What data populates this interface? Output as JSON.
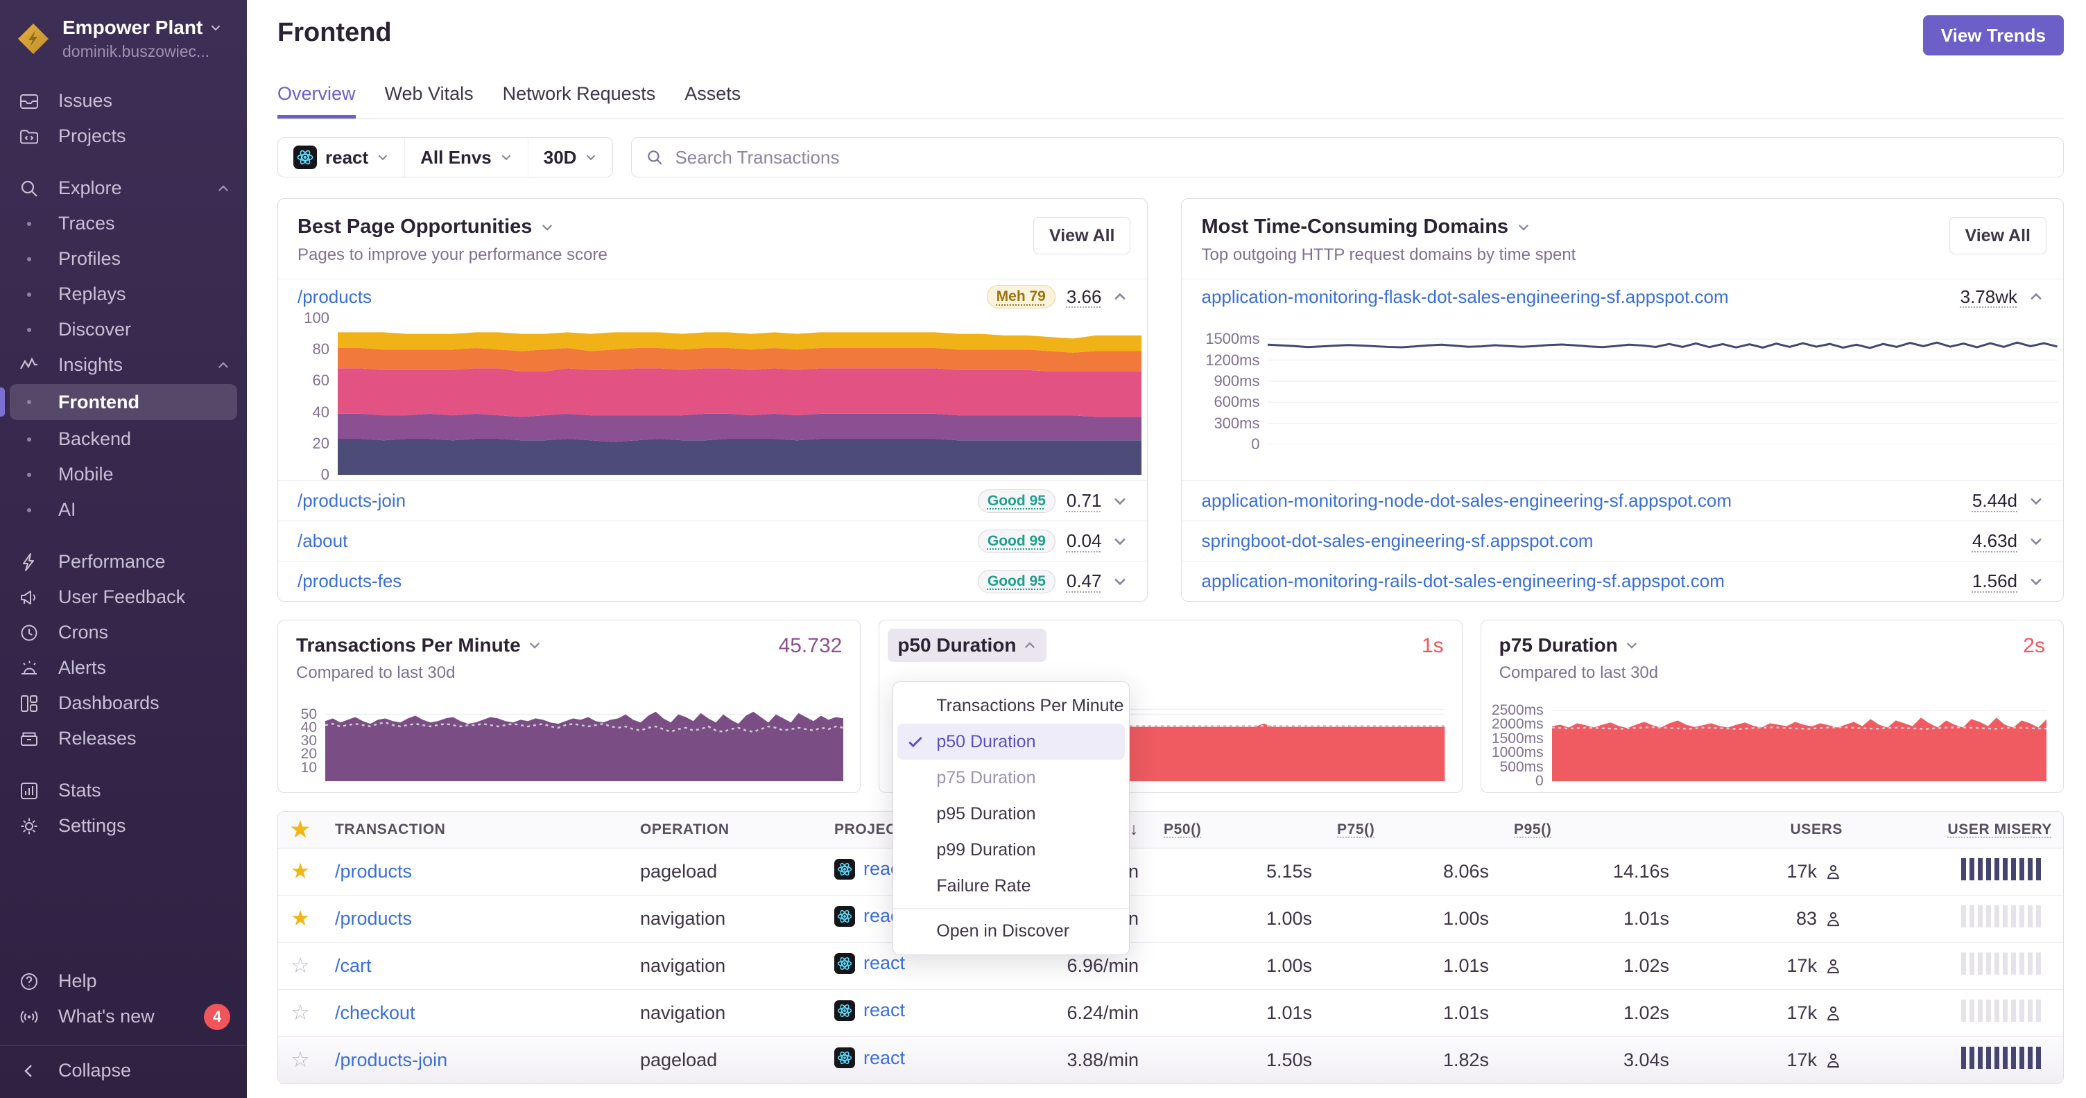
{
  "sidebar": {
    "org": {
      "name": "Empower Plant",
      "user": "dominik.buszowiec..."
    },
    "items": [
      {
        "id": "issues",
        "label": "Issues",
        "icon": "issues-icon"
      },
      {
        "id": "projects",
        "label": "Projects",
        "icon": "projects-icon"
      },
      {
        "id": "explore",
        "label": "Explore",
        "icon": "search-icon",
        "expandable": true,
        "gap": true
      },
      {
        "id": "traces",
        "label": "Traces",
        "sub": true
      },
      {
        "id": "profiles",
        "label": "Profiles",
        "sub": true
      },
      {
        "id": "replays",
        "label": "Replays",
        "sub": true
      },
      {
        "id": "discover",
        "label": "Discover",
        "sub": true
      },
      {
        "id": "insights",
        "label": "Insights",
        "icon": "insights-icon",
        "expandable": true
      },
      {
        "id": "frontend",
        "label": "Frontend",
        "sub": true,
        "active": true
      },
      {
        "id": "backend",
        "label": "Backend",
        "sub": true
      },
      {
        "id": "mobile",
        "label": "Mobile",
        "sub": true
      },
      {
        "id": "ai",
        "label": "AI",
        "sub": true
      },
      {
        "id": "performance",
        "label": "Performance",
        "icon": "lightning-icon",
        "gap": true
      },
      {
        "id": "user-feedback",
        "label": "User Feedback",
        "icon": "megaphone-icon"
      },
      {
        "id": "crons",
        "label": "Crons",
        "icon": "clock-icon"
      },
      {
        "id": "alerts",
        "label": "Alerts",
        "icon": "siren-icon"
      },
      {
        "id": "dashboards",
        "label": "Dashboards",
        "icon": "dashboards-icon"
      },
      {
        "id": "releases",
        "label": "Releases",
        "icon": "box-icon"
      },
      {
        "id": "stats",
        "label": "Stats",
        "icon": "bar-chart-icon",
        "gap": true
      },
      {
        "id": "settings",
        "label": "Settings",
        "icon": "gear-icon"
      }
    ],
    "footer": [
      {
        "id": "help",
        "label": "Help",
        "icon": "help-icon"
      },
      {
        "id": "whats-new",
        "label": "What's new",
        "icon": "broadcast-icon",
        "badge": "4"
      },
      {
        "id": "collapse",
        "label": "Collapse",
        "icon": "collapse-icon",
        "divider": true
      }
    ]
  },
  "header": {
    "title": "Frontend",
    "view_trends": "View Trends",
    "tabs": [
      {
        "label": "Overview",
        "active": true
      },
      {
        "label": "Web Vitals"
      },
      {
        "label": "Network Requests"
      },
      {
        "label": "Assets"
      }
    ]
  },
  "filters": {
    "project": "react",
    "env": "All Envs",
    "period": "30D",
    "search_placeholder": "Search Transactions"
  },
  "panels": {
    "bpo": {
      "title": "Best Page Opportunities",
      "subtitle": "Pages to improve your performance score",
      "view_all": "View All",
      "rows": [
        {
          "page": "/products",
          "badge": "Meh 79",
          "badge_type": "meh",
          "value": "3.66",
          "expanded": true
        },
        {
          "page": "/products-join",
          "badge": "Good 95",
          "badge_type": "good",
          "value": "0.71"
        },
        {
          "page": "/about",
          "badge": "Good 99",
          "badge_type": "good",
          "value": "0.04"
        },
        {
          "page": "/products-fes",
          "badge": "Good 95",
          "badge_type": "good",
          "value": "0.47"
        }
      ]
    },
    "domains": {
      "title": "Most Time-Consuming Domains",
      "subtitle": "Top outgoing HTTP request domains by time spent",
      "view_all": "View All",
      "rows": [
        {
          "domain": "application-monitoring-flask-dot-sales-engineering-sf.appspot.com",
          "value": "3.78wk",
          "expanded": true
        },
        {
          "domain": "application-monitoring-node-dot-sales-engineering-sf.appspot.com",
          "value": "5.44d"
        },
        {
          "domain": "springboot-dot-sales-engineering-sf.appspot.com",
          "value": "4.63d"
        },
        {
          "domain": "application-monitoring-rails-dot-sales-engineering-sf.appspot.com",
          "value": "1.56d"
        }
      ]
    },
    "tpm": {
      "title": "Transactions Per Minute",
      "value": "45.732",
      "subtitle": "Compared to last 30d"
    },
    "p50": {
      "title": "p50 Duration",
      "value": "1s"
    },
    "p75": {
      "title": "p75 Duration",
      "value": "2s",
      "subtitle": "Compared to last 30d"
    }
  },
  "dropdown": {
    "items": [
      {
        "label": "Transactions Per Minute"
      },
      {
        "label": "p50 Duration",
        "selected": true
      },
      {
        "label": "p75 Duration",
        "disabled": true
      },
      {
        "label": "p95 Duration"
      },
      {
        "label": "p99 Duration"
      },
      {
        "label": "Failure Rate"
      },
      {
        "label": "Open in Discover",
        "separated": true
      }
    ]
  },
  "table": {
    "sort_icon": "↓",
    "headers": [
      {
        "icon": "star",
        "align": "c"
      },
      {
        "label": "TRANSACTION"
      },
      {
        "label": "OPERATION"
      },
      {
        "label": "PROJECT"
      },
      {
        "label": "",
        "sort": "desc",
        "align": "r"
      },
      {
        "label": "P50()",
        "sortable": true
      },
      {
        "label": "P75()",
        "sortable": true
      },
      {
        "label": "P95()",
        "sortable": true
      },
      {
        "label": "USERS",
        "align": "r"
      },
      {
        "label": "USER MISERY",
        "sortable": true,
        "align": "r"
      }
    ],
    "rows": [
      {
        "starred": true,
        "transaction": "/products",
        "operation": "pageload",
        "project": "react",
        "tpm": "in",
        "p50": "5.15s",
        "p75": "8.06s",
        "p95": "14.16s",
        "users": "17k",
        "misery": "high"
      },
      {
        "starred": true,
        "transaction": "/products",
        "operation": "navigation",
        "project": "react",
        "tpm": "in",
        "p50": "1.00s",
        "p75": "1.00s",
        "p95": "1.01s",
        "users": "83",
        "misery": "low"
      },
      {
        "starred": false,
        "transaction": "/cart",
        "operation": "navigation",
        "project": "react",
        "tpm": "6.96/min",
        "p50": "1.00s",
        "p75": "1.01s",
        "p95": "1.02s",
        "users": "17k",
        "misery": "low"
      },
      {
        "starred": false,
        "transaction": "/checkout",
        "operation": "navigation",
        "project": "react",
        "tpm": "6.24/min",
        "p50": "1.01s",
        "p75": "1.01s",
        "p95": "1.02s",
        "users": "17k",
        "misery": "low"
      },
      {
        "starred": false,
        "transaction": "/products-join",
        "operation": "pageload",
        "project": "react",
        "tpm": "3.88/min",
        "p50": "1.50s",
        "p75": "1.82s",
        "p95": "3.04s",
        "users": "17k",
        "misery": "high"
      }
    ]
  },
  "icons": {
    "search-icon": "magnifier",
    "gear-icon": "gear",
    "star-icon": "star",
    "person-icon": "user silhouette",
    "chevron-down-icon": "v",
    "chevron-up-icon": "^",
    "check-icon": "checkmark",
    "react-icon": "react atom",
    "broadcast-icon": "((o))",
    "collapse-icon": "<",
    "sort-desc-icon": "down arrow"
  },
  "colors": {
    "accent": "#6C5FC7",
    "link": "#3A6FD6",
    "red": "#F0555C",
    "plum": "#8D4E8F",
    "stack": [
      "#4D4C78",
      "#8A5092",
      "#E25283",
      "#F2793C",
      "#F0B216"
    ],
    "domain_line": "#444674",
    "misery_high": "#46456F",
    "misery_low": "#E5E3E9",
    "badge_good_text": "#1D9F8B",
    "badge_meh_text": "#9A7410",
    "whats_new_badge": "#F0555C"
  },
  "chart_data": [
    {
      "id": "score-breakdown",
      "type": "area",
      "stacked": true,
      "panel": "Best Page Opportunities /products",
      "ylim": [
        0,
        100
      ],
      "yticks": [
        {
          "v": 100,
          "label": "100"
        },
        {
          "v": 80,
          "label": "80"
        },
        {
          "v": 60,
          "label": "60"
        },
        {
          "v": 40,
          "label": "40"
        },
        {
          "v": 20,
          "label": "20"
        },
        {
          "v": 0,
          "label": "0"
        }
      ],
      "series": [
        {
          "color": "#4D4C78",
          "values": [
            23,
            23,
            22,
            23,
            23,
            22,
            23,
            23,
            22,
            22,
            23,
            22,
            21,
            22,
            23,
            22,
            22,
            23,
            23,
            23,
            22,
            23,
            23,
            23,
            23,
            23,
            23,
            22,
            22,
            22,
            22,
            22,
            22,
            22,
            22,
            22
          ]
        },
        {
          "color": "#8A5092",
          "values": [
            16,
            16,
            16,
            15,
            16,
            16,
            16,
            15,
            15,
            16,
            16,
            16,
            17,
            16,
            15,
            16,
            17,
            16,
            15,
            16,
            16,
            16,
            16,
            16,
            16,
            16,
            16,
            16,
            16,
            16,
            16,
            16,
            16,
            15,
            15,
            15
          ]
        },
        {
          "color": "#E25283",
          "values": [
            29,
            29,
            29,
            29,
            28,
            29,
            29,
            30,
            29,
            28,
            29,
            29,
            29,
            30,
            30,
            29,
            29,
            29,
            29,
            29,
            29,
            29,
            29,
            29,
            29,
            29,
            29,
            29,
            29,
            29,
            29,
            28,
            28,
            29,
            29,
            29
          ]
        },
        {
          "color": "#F2793C",
          "values": [
            13,
            13,
            13,
            13,
            13,
            13,
            13,
            12,
            13,
            14,
            13,
            12,
            13,
            13,
            13,
            13,
            13,
            13,
            13,
            13,
            13,
            13,
            13,
            13,
            13,
            13,
            13,
            13,
            13,
            13,
            13,
            13,
            12,
            13,
            13,
            13
          ]
        },
        {
          "color": "#F0B216",
          "values": [
            10,
            10,
            11,
            10,
            10,
            10,
            10,
            11,
            11,
            10,
            10,
            11,
            11,
            10,
            10,
            10,
            10,
            10,
            10,
            10,
            10,
            10,
            10,
            10,
            10,
            10,
            10,
            10,
            10,
            9,
            9,
            9,
            9,
            10,
            10,
            10
          ]
        }
      ]
    },
    {
      "id": "domain-response",
      "type": "line",
      "panel": "Most Time-Consuming Domains flask",
      "ylim": [
        0,
        1600
      ],
      "color": "#444674",
      "grid": [
        1500,
        1200,
        900,
        600,
        300,
        0
      ],
      "yticks": [
        {
          "v": 1500,
          "label": "1500ms"
        },
        {
          "v": 1200,
          "label": "1200ms"
        },
        {
          "v": 900,
          "label": "900ms"
        },
        {
          "v": 600,
          "label": "600ms"
        },
        {
          "v": 300,
          "label": "300ms"
        },
        {
          "v": 0,
          "label": "0"
        }
      ],
      "values": [
        1420,
        1410,
        1400,
        1385,
        1395,
        1405,
        1415,
        1408,
        1398,
        1388,
        1383,
        1395,
        1410,
        1420,
        1405,
        1390,
        1396,
        1412,
        1400,
        1390,
        1400,
        1415,
        1422,
        1410,
        1395,
        1385,
        1400,
        1420,
        1408,
        1388,
        1430,
        1388,
        1438,
        1385,
        1428,
        1380,
        1425,
        1378,
        1435,
        1388,
        1440,
        1392,
        1430,
        1378,
        1420,
        1374,
        1430,
        1388,
        1445,
        1398,
        1450,
        1392,
        1435,
        1383,
        1440,
        1388,
        1450,
        1398,
        1440,
        1393
      ]
    },
    {
      "id": "tpm",
      "type": "area",
      "panel": "Transactions Per Minute",
      "ylim": [
        0,
        55
      ],
      "color": "#7A4E85",
      "grid": [
        50
      ],
      "yticks": [
        {
          "v": 50,
          "label": "50"
        },
        {
          "v": 40,
          "label": "40"
        },
        {
          "v": 30,
          "label": "30"
        },
        {
          "v": 20,
          "label": "20"
        },
        {
          "v": 10,
          "label": "10"
        }
      ],
      "values": [
        45,
        47,
        44,
        46,
        48,
        45,
        43,
        46,
        47,
        45,
        44,
        47,
        49,
        46,
        44,
        45,
        47,
        48,
        45,
        43,
        44,
        46,
        48,
        47,
        45,
        44,
        46,
        45,
        47,
        46,
        44,
        43,
        45,
        47,
        46,
        48,
        45,
        44,
        46,
        47,
        50,
        46,
        44,
        49,
        52,
        47,
        44,
        50,
        48,
        45,
        51,
        47,
        44,
        50,
        46,
        43,
        49,
        52,
        48,
        44,
        50,
        47,
        44,
        51,
        48,
        45,
        49,
        46,
        48,
        47
      ],
      "compare": {
        "color": "#CFC9D6",
        "values": [
          42,
          43,
          41,
          42,
          43,
          42,
          41,
          43,
          44,
          42,
          41,
          42,
          43,
          42,
          41,
          42,
          43,
          42,
          41,
          42,
          42,
          43,
          42,
          41,
          42,
          43,
          42,
          41,
          42,
          43,
          41,
          40,
          42,
          43,
          42,
          41,
          42,
          43,
          41,
          40,
          41,
          39,
          38,
          40,
          41,
          39,
          37,
          39,
          40,
          38,
          39,
          41,
          38,
          37,
          39,
          40,
          38,
          37,
          39,
          41,
          40,
          38,
          39,
          40,
          39,
          38,
          40,
          39,
          41,
          40
        ]
      }
    },
    {
      "id": "p50",
      "type": "area",
      "panel": "p50 Duration",
      "ylim": [
        0,
        1350
      ],
      "color": "#EF5B61",
      "grid": [
        1320,
        1230
      ],
      "yticks": [],
      "values": [
        1000,
        1000,
        1000,
        1000,
        1000,
        1000,
        1000,
        1000,
        1000,
        1000,
        1000,
        1000,
        1240,
        1000,
        1000,
        1000,
        1000,
        1000,
        1000,
        1000,
        1000,
        1000,
        1000,
        1000,
        1000,
        1000,
        1000,
        1000,
        1000,
        1000,
        1000,
        1000,
        1000,
        1000,
        1000,
        1000,
        1000,
        1000,
        1060,
        1000,
        1000,
        1000,
        1000,
        1000,
        1000,
        1000,
        1000,
        1000,
        1000,
        1000,
        1000,
        1000,
        1000,
        1000,
        1000,
        1000,
        1000,
        1000,
        1000,
        1000
      ],
      "compare": {
        "color": "#CFC9D6",
        "values": [
          1015,
          1015
        ]
      }
    },
    {
      "id": "p75",
      "type": "area",
      "panel": "p75 Duration",
      "ylim": [
        0,
        2600
      ],
      "color": "#EF5B61",
      "grid": [
        2500
      ],
      "yticks": [
        {
          "v": 2500,
          "label": "2500ms"
        },
        {
          "v": 2000,
          "label": "2000ms"
        },
        {
          "v": 1500,
          "label": "1500ms"
        },
        {
          "v": 1000,
          "label": "1000ms"
        },
        {
          "v": 500,
          "label": "500ms"
        },
        {
          "v": 0,
          "label": "0"
        }
      ],
      "values": [
        1950,
        2000,
        1900,
        2050,
        1980,
        1900,
        2000,
        2080,
        1950,
        1880,
        2000,
        2100,
        1980,
        1900,
        2050,
        2150,
        2000,
        1920,
        1980,
        2050,
        1950,
        1900,
        2000,
        2080,
        1960,
        1900,
        2050,
        2000,
        1950,
        2100,
        2000,
        1940,
        2050,
        1980,
        1900,
        2000,
        2100,
        1950,
        2200,
        2000,
        1900,
        2150,
        2050,
        1950,
        2250,
        2050,
        1900,
        2150,
        2000,
        1900,
        2200,
        2100,
        1950,
        2250,
        2000,
        1900,
        2150,
        2050,
        1900,
        2200
      ],
      "compare": {
        "color": "#CFC9D6",
        "values": [
          1900,
          1860,
          1895,
          1870,
          1850,
          1890,
          1915,
          1880,
          1850,
          1900,
          1870,
          1845,
          1890,
          1910,
          1875,
          1850,
          1895,
          1915,
          1880,
          1855,
          1900,
          1870,
          1850,
          1895,
          1910,
          1880,
          1855,
          1900,
          1875,
          1860
        ]
      }
    }
  ]
}
